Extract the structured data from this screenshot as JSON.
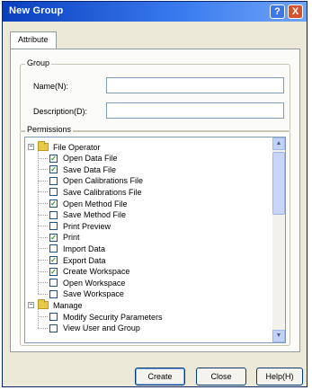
{
  "window": {
    "title": "New Group",
    "help_glyph": "?",
    "close_glyph": "X"
  },
  "tabs": [
    {
      "label": "Attribute"
    }
  ],
  "group_box": {
    "label": "Group",
    "name_label": "Name(N):",
    "name_value": "",
    "description_label": "Description(D):",
    "description_value": ""
  },
  "permissions": {
    "label": "Permissions",
    "categories": [
      {
        "label": "File Operator",
        "expander": "−",
        "items": [
          {
            "label": "Open Data File",
            "checked": true
          },
          {
            "label": "Save Data File",
            "checked": true
          },
          {
            "label": "Open Calibrations File",
            "checked": false
          },
          {
            "label": "Save Calibrations File",
            "checked": false
          },
          {
            "label": "Open Method File",
            "checked": true
          },
          {
            "label": "Save Method File",
            "checked": false
          },
          {
            "label": "Print Preview",
            "checked": false
          },
          {
            "label": "Print",
            "checked": true
          },
          {
            "label": "Import Data",
            "checked": false
          },
          {
            "label": "Export Data",
            "checked": true
          },
          {
            "label": "Create Workspace",
            "checked": true
          },
          {
            "label": "Open Workspace",
            "checked": false
          },
          {
            "label": "Save Workspace",
            "checked": false
          }
        ]
      },
      {
        "label": "Manage",
        "expander": "−",
        "items": [
          {
            "label": "Modify Security Parameters",
            "checked": false
          },
          {
            "label": "View User and Group",
            "checked": false
          }
        ]
      }
    ],
    "check_glyph": "✓",
    "scroll_up": "▲",
    "scroll_down": "▼"
  },
  "buttons": {
    "create": "Create",
    "close": "Close",
    "help": "Help(H)"
  },
  "colors": {
    "titlebar": "#0a3fbd",
    "check": "#21a121",
    "folder": "#e6c84a"
  }
}
